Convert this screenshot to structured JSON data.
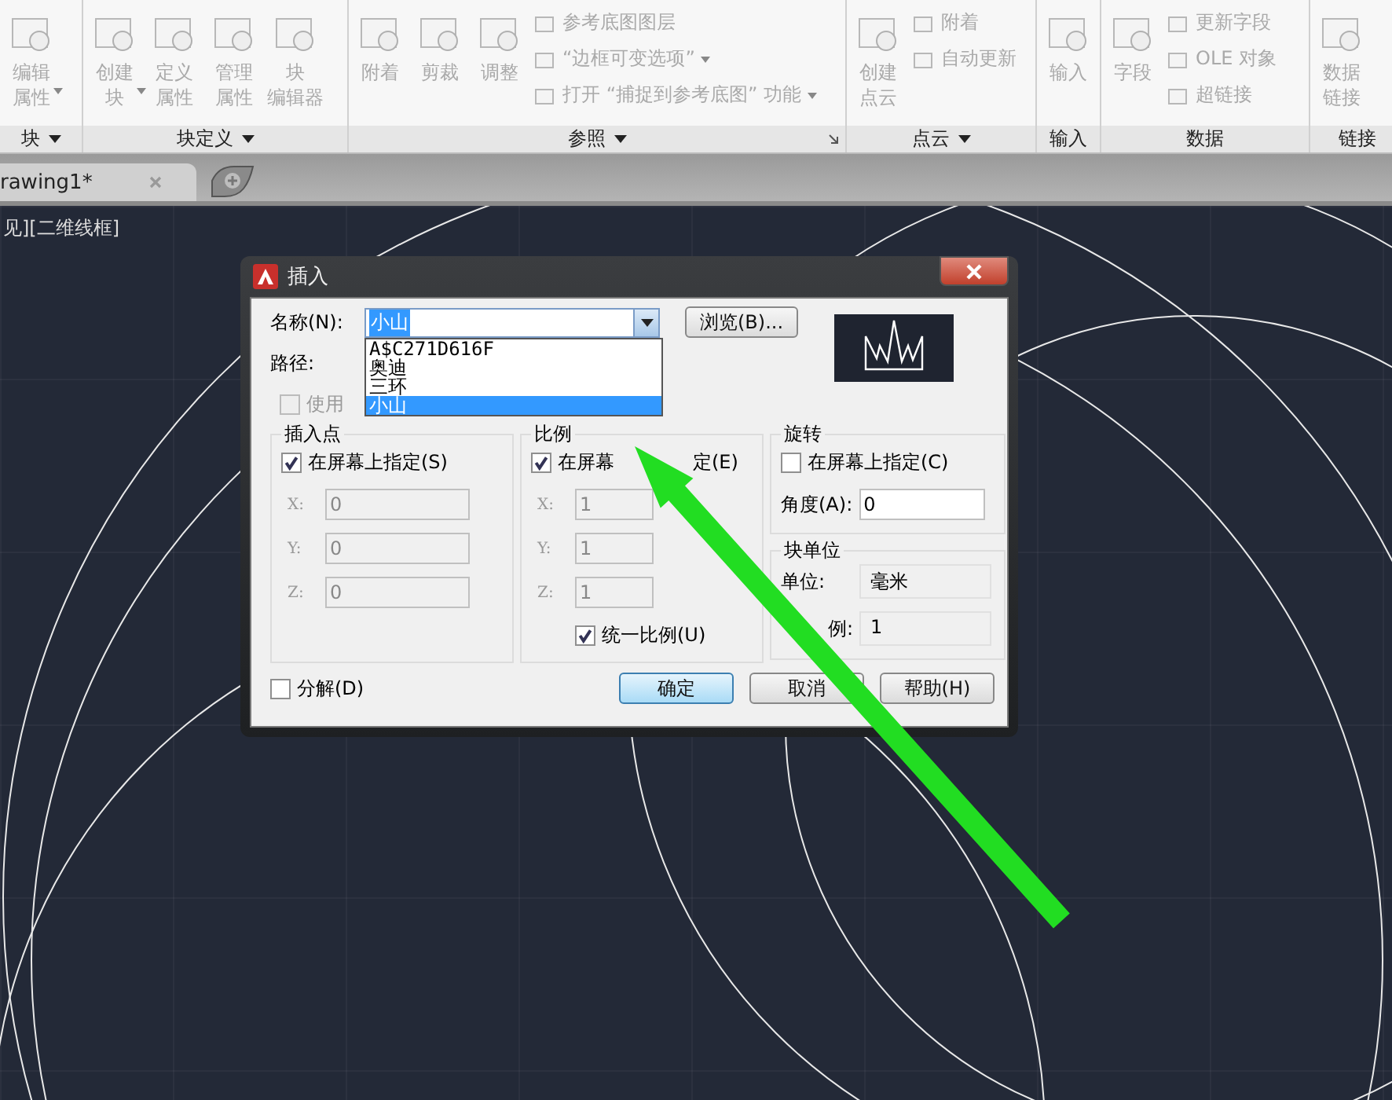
{
  "ribbon": {
    "panels": [
      {
        "title": "块",
        "menu": true,
        "launcher": false,
        "large": [
          {
            "lines": [
              "编辑",
              "属性"
            ],
            "dropdown": true
          }
        ]
      },
      {
        "title": "块定义",
        "menu": true,
        "launcher": false,
        "large": [
          {
            "lines": [
              "创建",
              "块"
            ],
            "dropdown": true
          },
          {
            "lines": [
              "定义",
              "属性"
            ],
            "dropdown": false
          },
          {
            "lines": [
              "管理",
              "属性"
            ],
            "dropdown": false
          },
          {
            "lines": [
              "块",
              "编辑器"
            ],
            "dropdown": false
          }
        ]
      },
      {
        "title": "参照",
        "menu": true,
        "launcher": true,
        "large": [
          {
            "lines": [
              "附着"
            ],
            "dropdown": false
          },
          {
            "lines": [
              "剪裁"
            ],
            "dropdown": false
          },
          {
            "lines": [
              "调整"
            ],
            "dropdown": false
          }
        ],
        "small": [
          {
            "label": "参考底图图层",
            "dropdown": false
          },
          {
            "label": "“边框可变选项”",
            "dropdown": true
          },
          {
            "label": "打开 “捕捉到参考底图” 功能",
            "dropdown": true
          }
        ]
      },
      {
        "title": "点云",
        "menu": true,
        "launcher": false,
        "large": [
          {
            "lines": [
              "创建",
              "点云"
            ],
            "dropdown": false
          }
        ],
        "small": [
          {
            "label": "附着",
            "dropdown": false
          },
          {
            "label": "自动更新",
            "dropdown": false
          }
        ]
      },
      {
        "title": "输入",
        "menu": false,
        "launcher": false,
        "large": [
          {
            "lines": [
              "输入"
            ],
            "dropdown": false
          }
        ]
      },
      {
        "title": "数据",
        "menu": false,
        "launcher": false,
        "large": [
          {
            "lines": [
              "字段"
            ],
            "dropdown": false
          }
        ],
        "small": [
          {
            "label": "更新字段",
            "dropdown": false
          },
          {
            "label": "OLE 对象",
            "dropdown": false
          },
          {
            "label": "超链接",
            "dropdown": false
          }
        ]
      },
      {
        "title": "链接",
        "menu": false,
        "launcher": false,
        "large": [
          {
            "lines": [
              "数据",
              "链接"
            ],
            "dropdown": false
          }
        ]
      }
    ]
  },
  "tabs": [
    {
      "label": "rawing1*",
      "selected": true
    }
  ],
  "viewport_label": "见][二维线框]",
  "dialog": {
    "title": "插入",
    "name": {
      "label": "名称(N):",
      "value": "小山",
      "expanded": true,
      "options": [
        {
          "label": "A$C271D616F",
          "selected": false
        },
        {
          "label": "奥迪",
          "selected": false
        },
        {
          "label": "三环",
          "selected": false
        },
        {
          "label": "小山",
          "selected": true
        }
      ]
    },
    "browse_button": "浏览(B)...",
    "path_label": "路径:",
    "use_geo": {
      "label": "使用",
      "checked": false
    },
    "insertion_point": {
      "title": "插入点",
      "on_screen": {
        "label": "在屏幕上指定(S)",
        "checked": true
      },
      "fields": [
        {
          "label": "X:",
          "value": "0"
        },
        {
          "label": "Y:",
          "value": "0"
        },
        {
          "label": "Z:",
          "value": "0"
        }
      ]
    },
    "scale": {
      "title": "比例",
      "on_screen": {
        "label": "在屏幕",
        "label_tail": "定(E)",
        "checked": true
      },
      "fields": [
        {
          "label": "X:",
          "value": "1"
        },
        {
          "label": "Y:",
          "value": "1"
        },
        {
          "label": "Z:",
          "value": "1"
        }
      ],
      "uniform": {
        "label": "统一比例(U)",
        "checked": true
      }
    },
    "rotation": {
      "title": "旋转",
      "on_screen": {
        "label": "在屏幕上指定(C)",
        "checked": false
      },
      "angle": {
        "label": "角度(A):",
        "value": "0"
      }
    },
    "block_unit": {
      "title": "块单位",
      "unit": {
        "label": "单位:",
        "value": "毫米"
      },
      "factor": {
        "label": "例:",
        "value": "1"
      }
    },
    "explode": {
      "label": "分解(D)",
      "checked": false
    },
    "buttons": [
      {
        "label": "确定",
        "default": true
      },
      {
        "label": "取消",
        "default": false
      },
      {
        "label": "帮助(H)",
        "default": false
      }
    ]
  }
}
